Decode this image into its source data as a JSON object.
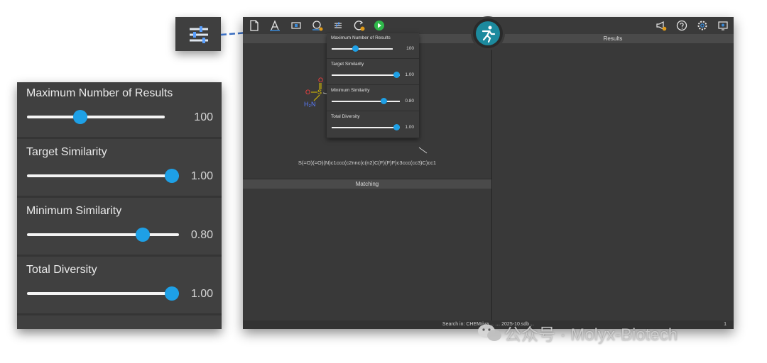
{
  "zoom_panel": {
    "sliders": [
      {
        "label": "Maximum Number of Results",
        "value": "100",
        "fraction": 0.41
      },
      {
        "label": "Target Similarity",
        "value": "1.00",
        "fraction": 1.0
      },
      {
        "label": "Minimum Similarity",
        "value": "0.80",
        "fraction": 0.8
      },
      {
        "label": "Total Diversity",
        "value": "1.00",
        "fraction": 1.0
      }
    ]
  },
  "popup": {
    "sliders": [
      {
        "label": "Maximum Number of Results",
        "value": "100",
        "fraction": 0.41
      },
      {
        "label": "Target Similarity",
        "value": "1.00",
        "fraction": 1.0
      },
      {
        "label": "Minimum Similarity",
        "value": "0.80",
        "fraction": 0.8
      },
      {
        "label": "Total Diversity",
        "value": "1.00",
        "fraction": 1.0
      }
    ]
  },
  "app": {
    "results_header": "Results",
    "matching_header": "Matching",
    "smiles": "S(=O)(=O)(N)c1ccc(c2nnc(c(n2)C(F)(F)F)c3ccc(cc3)C)cc1",
    "status": "Search in: CHEMriya… … 2025-10.sdb…",
    "status_count": "1",
    "molecule": {
      "o_top": "O",
      "o_left": "O",
      "s": "S",
      "nh2": "H₂N"
    }
  },
  "toolbar": {
    "icons": [
      "new-document-icon",
      "text-icon",
      "screen-icon",
      "search-settings-icon",
      "sliders-icon",
      "refresh-icon",
      "run-icon",
      "megaphone-icon",
      "help-icon",
      "settings-icon",
      "monitor-icon"
    ]
  },
  "watermark": {
    "text": "公众号 · Molyx-Biotech"
  },
  "colors": {
    "accent": "#1ea0e6",
    "panel": "#404040",
    "background": "#2b2b2b",
    "logo": "#1c8a9e",
    "connector": "#3a6fc4"
  }
}
